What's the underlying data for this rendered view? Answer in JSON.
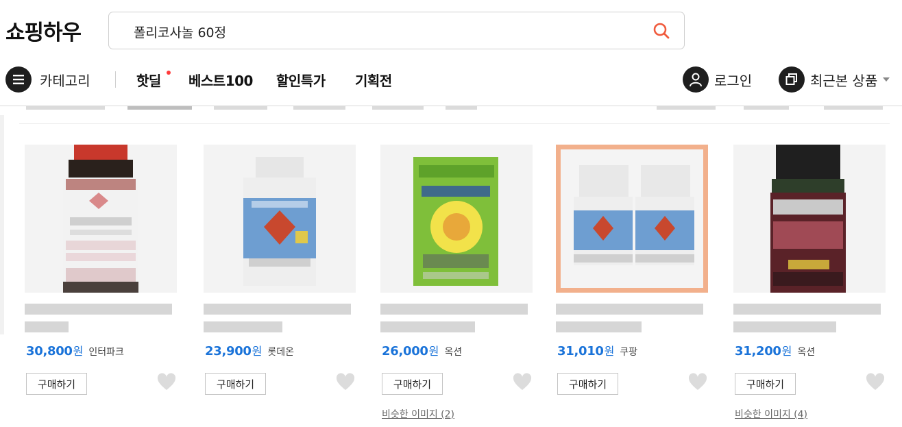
{
  "header": {
    "logo": "쇼핑하우",
    "search": {
      "value": "폴리코사놀 60정",
      "placeholder": ""
    }
  },
  "nav": {
    "category_label": "카테고리",
    "links": [
      "핫딜",
      "베스트100",
      "할인특가",
      "기획전"
    ],
    "login_label": "로그인",
    "recent_label": "최근본 상품"
  },
  "colors": {
    "price": "#1a73d9",
    "highlight_border": "#f2b08c",
    "hot_dot": "#ff3b3b"
  },
  "products": [
    {
      "price": "30,800",
      "won": "원",
      "mall": "인터파크",
      "buy": "구매하기",
      "similar": ""
    },
    {
      "price": "23,900",
      "won": "원",
      "mall": "롯데온",
      "buy": "구매하기",
      "similar": ""
    },
    {
      "price": "26,000",
      "won": "원",
      "mall": "옥션",
      "buy": "구매하기",
      "similar": "비슷한 이미지 (2)"
    },
    {
      "price": "31,010",
      "won": "원",
      "mall": "쿠팡",
      "buy": "구매하기",
      "similar": ""
    },
    {
      "price": "31,200",
      "won": "원",
      "mall": "옥션",
      "buy": "구매하기",
      "similar": "비슷한 이미지 (4)"
    }
  ]
}
